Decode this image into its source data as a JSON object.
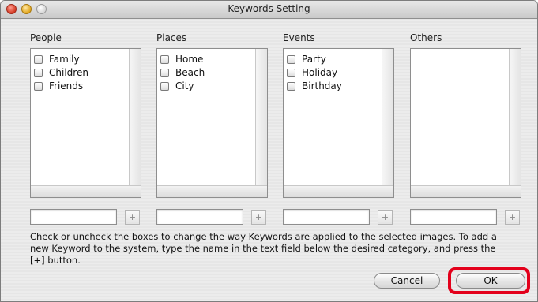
{
  "window": {
    "title": "Keywords Setting"
  },
  "categories": [
    {
      "label": "People",
      "items": [
        "Family",
        "Children",
        "Friends"
      ]
    },
    {
      "label": "Places",
      "items": [
        "Home",
        "Beach",
        "City"
      ]
    },
    {
      "label": "Events",
      "items": [
        "Party",
        "Holiday",
        "Birthday"
      ]
    },
    {
      "label": "Others",
      "items": []
    }
  ],
  "add_button_label": "+",
  "help_text": "Check or uncheck the boxes to change the way Keywords are applied to the selected images. To add a new Keyword to the system, type the name in the text field below the desired category, and press the [+] button.",
  "buttons": {
    "cancel": "Cancel",
    "ok": "OK"
  },
  "colors": {
    "highlight": "#e3001b"
  }
}
